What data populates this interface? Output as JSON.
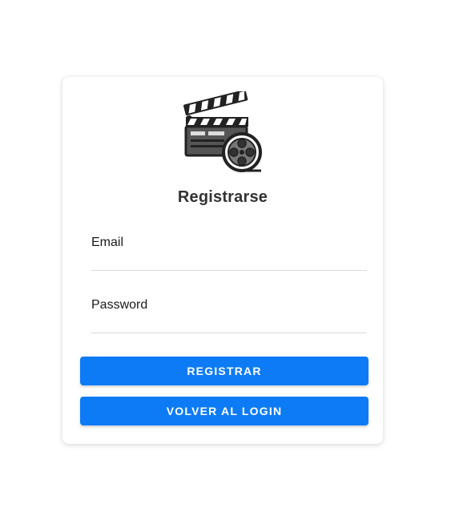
{
  "colors": {
    "primary": "#0d7bf5",
    "title_text": "#333333",
    "divider": "#d9d9d9"
  },
  "logo": {
    "icon": "movie-clapperboard-film-reel-icon"
  },
  "form": {
    "title": "Registrarse",
    "email": {
      "placeholder": "Email",
      "value": ""
    },
    "password": {
      "placeholder": "Password",
      "value": ""
    },
    "register_label": "REGISTRAR",
    "back_label": "VOLVER AL LOGIN"
  }
}
